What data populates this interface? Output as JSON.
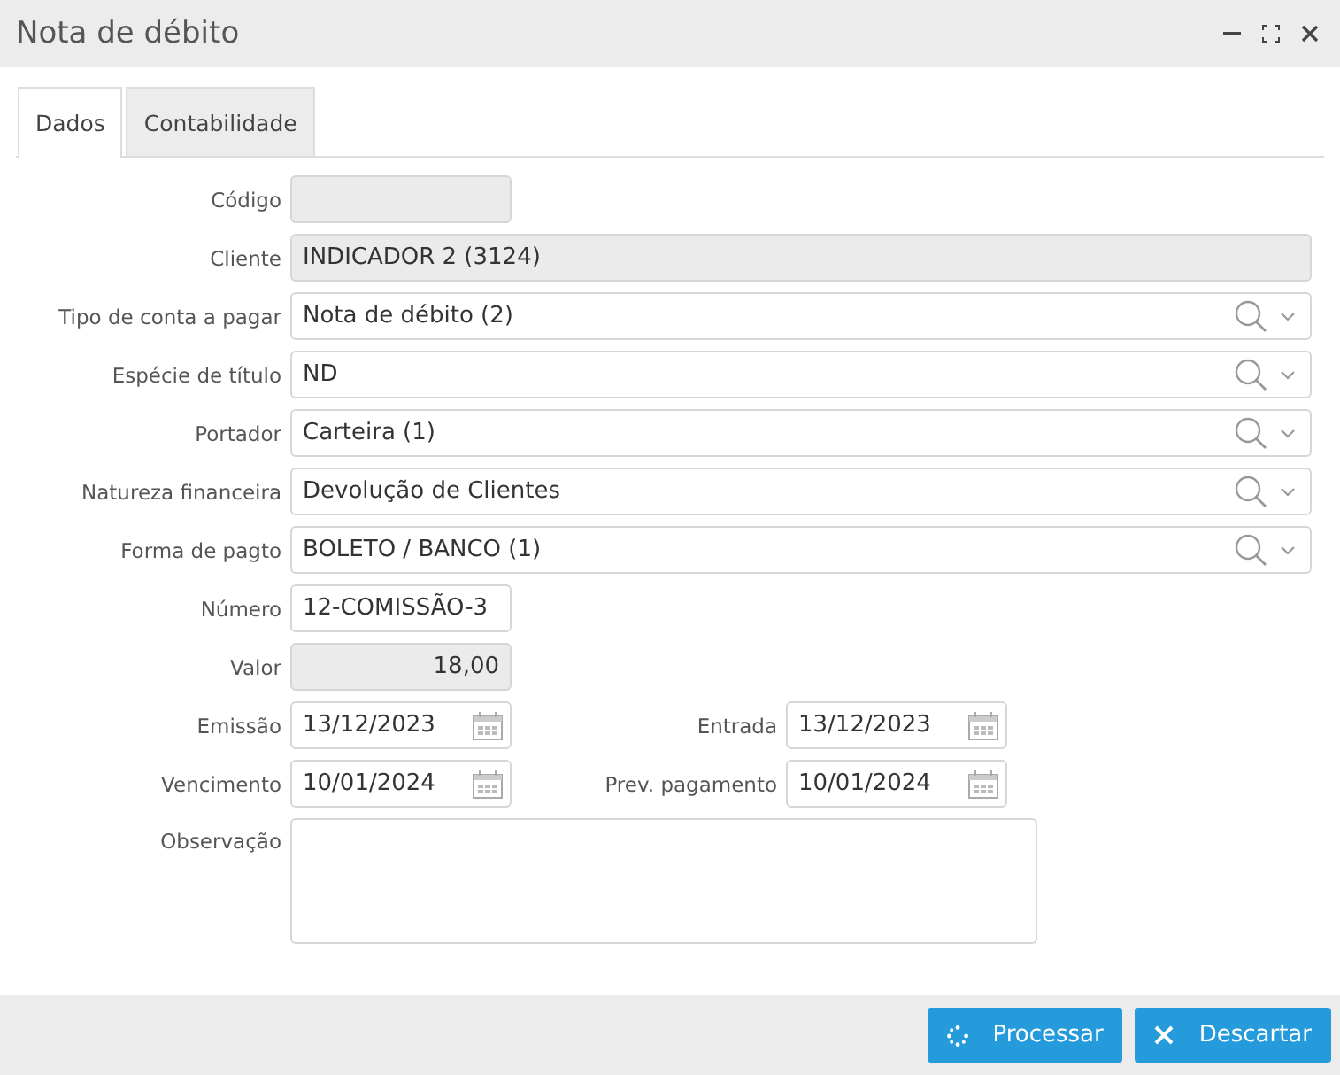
{
  "window": {
    "title": "Nota de débito"
  },
  "tabs": [
    {
      "label": "Dados",
      "selected": true
    },
    {
      "label": "Contabilidade",
      "selected": false
    }
  ],
  "form": [
    {
      "kind": "short",
      "label": "Código",
      "disabled": true
    },
    {
      "kind": "full",
      "label": "Cliente",
      "value": "INDICADOR 2 (3124)",
      "disabled": true
    },
    {
      "kind": "lookup",
      "label": "Tipo de conta a pagar",
      "value": "Nota de débito (2)"
    },
    {
      "kind": "lookup",
      "label": "Espécie de título",
      "value": "ND"
    },
    {
      "kind": "lookup",
      "label": "Portador",
      "value": "Carteira (1)"
    },
    {
      "kind": "lookup",
      "label": "Natureza financeira",
      "value": "Devolução de Clientes"
    },
    {
      "kind": "lookup",
      "label": "Forma de pagto",
      "value": "BOLETO / BANCO (1)"
    },
    {
      "kind": "short",
      "label": "Número",
      "value": "12-COMISSÃO-3",
      "disabled": false
    },
    {
      "kind": "amount",
      "label": "Valor",
      "value": "18,00",
      "disabled": true
    },
    {
      "kind": "dates",
      "label": "Emissão",
      "value": "13/12/2023",
      "label_2": "Entrada",
      "value_2": "13/12/2023"
    },
    {
      "kind": "dates",
      "label": "Vencimento",
      "value": "10/01/2024",
      "label_2": "Prev. pagamento",
      "value_2": "10/01/2024"
    },
    {
      "kind": "memo",
      "label": "Observação"
    }
  ],
  "buttons": [
    {
      "kind": "process",
      "label": "Processar"
    },
    {
      "kind": "discard",
      "label": "Descartar"
    }
  ]
}
